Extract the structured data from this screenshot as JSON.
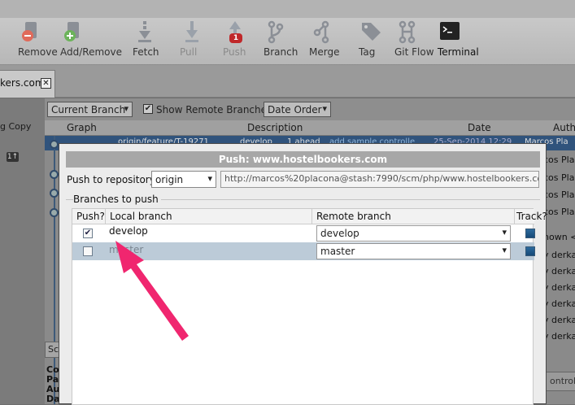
{
  "toolbar": {
    "buttons": [
      {
        "label": "Remove",
        "icon": "remove-icon",
        "enabled": true
      },
      {
        "label": "Add/Remove",
        "icon": "add-remove-icon",
        "enabled": true
      },
      {
        "label": "Fetch",
        "icon": "fetch-icon",
        "enabled": true
      },
      {
        "label": "Pull",
        "icon": "pull-icon",
        "enabled": false
      },
      {
        "label": "Push",
        "icon": "push-icon",
        "enabled": false,
        "badge": "1"
      },
      {
        "label": "Branch",
        "icon": "branch-icon",
        "enabled": true
      },
      {
        "label": "Merge",
        "icon": "merge-icon",
        "enabled": true
      },
      {
        "label": "Tag",
        "icon": "tag-icon",
        "enabled": true
      },
      {
        "label": "Git Flow",
        "icon": "git-flow-icon",
        "enabled": true
      },
      {
        "label": "Terminal",
        "icon": "terminal-icon",
        "enabled": true
      }
    ]
  },
  "tab": {
    "label": "kers.com",
    "close": "✕"
  },
  "sidebar": {
    "working_copy": "g Copy",
    "count": "1↑"
  },
  "history": {
    "branch_filter": "Current Branch",
    "show_remote_label": "Show Remote Branches",
    "show_remote_checked": true,
    "order": "Date Order",
    "columns": {
      "graph": "Graph",
      "description": "Description",
      "date": "Date",
      "author": "Auth"
    },
    "selected_row": {
      "ref1": "origin/feature/T-19271",
      "ref2": "develop",
      "ahead": "1 ahead",
      "desc": "add sample controlle",
      "date": "25-Sep-2014 12:29",
      "author": "Marcos Pla"
    },
    "authors": [
      "Marcos Pla",
      "cos Pla",
      "cos Pla",
      "cos Pla",
      "cos Pla",
      "nown <",
      "y derka",
      "y derka",
      "y derka",
      "y derka",
      "y derka",
      "os Vacz",
      "y derka",
      "y derka"
    ],
    "bottom_left": "Sc",
    "bold_labels": [
      "Co",
      "Pa",
      "Au",
      "Da"
    ],
    "side_button": "ontrolle"
  },
  "dialog": {
    "title": "Push: www.hostelbookers.com",
    "push_to_label": "Push to repository:",
    "repository": "origin",
    "url": "http://marcos%20placona@stash:7990/scm/php/www.hostelbookers.com",
    "branches_label": "Branches to push",
    "columns": {
      "push": "Push?",
      "local": "Local branch",
      "remote": "Remote branch",
      "track": "Track?"
    },
    "rows": [
      {
        "push": true,
        "local": "develop",
        "remote": "develop",
        "track": true
      },
      {
        "push": false,
        "local": "master",
        "remote": "master",
        "track": true
      }
    ]
  },
  "colors": {
    "accent_arrow": "#f0266f",
    "selection": "#30537c",
    "alt_row": "#bccbd8"
  }
}
